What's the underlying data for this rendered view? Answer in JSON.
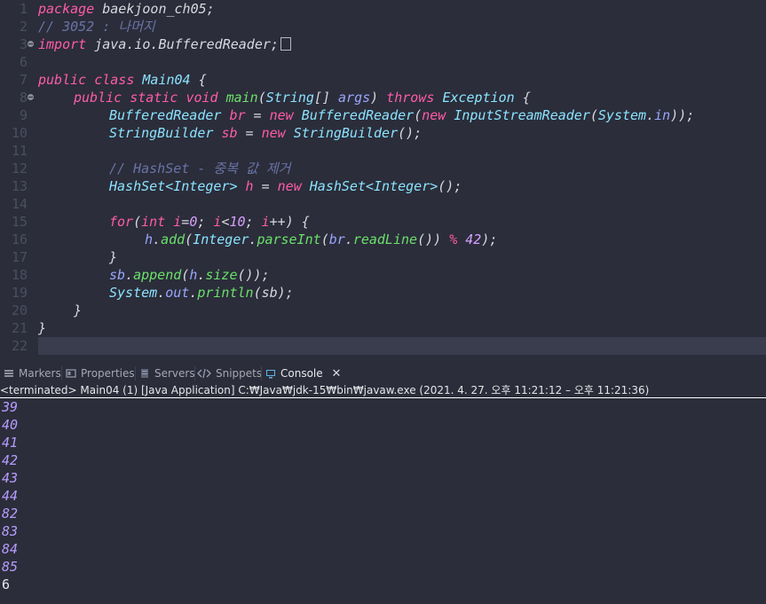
{
  "editor": {
    "line_numbers": [
      "1",
      "2",
      "3",
      "6",
      "7",
      "8",
      "9",
      "10",
      "11",
      "12",
      "13",
      "14",
      "15",
      "16",
      "17",
      "18",
      "19",
      "20",
      "21",
      "22"
    ],
    "code": {
      "l1_kw": "package",
      "l1_rest": " baekjoon_ch05;",
      "l2_comment": "// 3052 : 나머지",
      "l3_kw": "import",
      "l3_rest": " java.io.BufferedReader;",
      "l7_public": "public",
      "l7_class": "class",
      "l7_name": "Main04",
      "l7_brace": " {",
      "l8_public": "public",
      "l8_static": "static",
      "l8_void": "void",
      "l8_main": "main",
      "l8_string": "String",
      "l8_arr": "[] ",
      "l8_args": "args",
      "l8_throws": "throws",
      "l8_exc": "Exception",
      "l8_brace": " {",
      "l9_type": "BufferedReader",
      "l9_var": "br",
      "l9_eq": " = ",
      "l9_new": "new",
      "l9_ctor": "BufferedReader",
      "l9_p1": "(",
      "l9_new2": "new",
      "l9_ctor2": "InputStreamReader",
      "l9_p2": "(",
      "l9_sys": "System",
      "l9_dot": ".",
      "l9_in": "in",
      "l9_end": "));",
      "l10_type": "StringBuilder",
      "l10_var": "sb",
      "l10_eq": " = ",
      "l10_new": "new",
      "l10_ctor": "StringBuilder",
      "l10_end": "();",
      "l12_comment": "// HashSet - 중복 값 제거",
      "l13_type": "HashSet<Integer>",
      "l13_var": "h",
      "l13_eq": " = ",
      "l13_new": "new",
      "l13_ctor": "HashSet<Integer>",
      "l13_end": "();",
      "l15_for": "for",
      "l15_p": "(",
      "l15_int": "int",
      "l15_i": "i",
      "l15_eq": "=",
      "l15_0": "0",
      "l15_s1": "; ",
      "l15_i2": "i",
      "l15_lt": "<",
      "l15_10": "10",
      "l15_s2": "; ",
      "l15_i3": "i",
      "l15_pp": "++",
      "l15_end": ") {",
      "l16_h": "h",
      "l16_dot": ".",
      "l16_add": "add",
      "l16_p": "(",
      "l16_int": "Integer",
      "l16_dot2": ".",
      "l16_parse": "parseInt",
      "l16_p2": "(",
      "l16_br": "br",
      "l16_dot3": ".",
      "l16_read": "readLine",
      "l16_mid": "()) ",
      "l16_mod": "%",
      "l16_sp": " ",
      "l16_42": "42",
      "l16_end": ");",
      "l17": "}",
      "l18_sb": "sb",
      "l18_dot": ".",
      "l18_append": "append",
      "l18_p": "(",
      "l18_h": "h",
      "l18_dot2": ".",
      "l18_size": "size",
      "l18_end": "());",
      "l19_sys": "System",
      "l19_dot": ".",
      "l19_out": "out",
      "l19_dot2": ".",
      "l19_println": "println",
      "l19_end": "(sb);",
      "l20": "}",
      "l21": "}"
    }
  },
  "tabs": [
    {
      "label": "Markers"
    },
    {
      "label": "Properties"
    },
    {
      "label": "Servers"
    },
    {
      "label": "Snippets"
    },
    {
      "label": "Console"
    }
  ],
  "console": {
    "status": "<terminated> Main04 (1) [Java Application] C:₩Java₩jdk-15₩bin₩javaw.exe  (2021. 4. 27. 오후 11:21:12 – 오후 11:21:36)",
    "inputs": [
      "39",
      "40",
      "41",
      "42",
      "43",
      "44",
      "82",
      "83",
      "84",
      "85"
    ],
    "result": "6"
  },
  "colors": {
    "background": "#2b2d3a",
    "keyword": "#ff5ca8",
    "type": "#8be3ff",
    "method": "#6be06b",
    "comment": "#6a73a6",
    "console_input": "#b79cff"
  }
}
